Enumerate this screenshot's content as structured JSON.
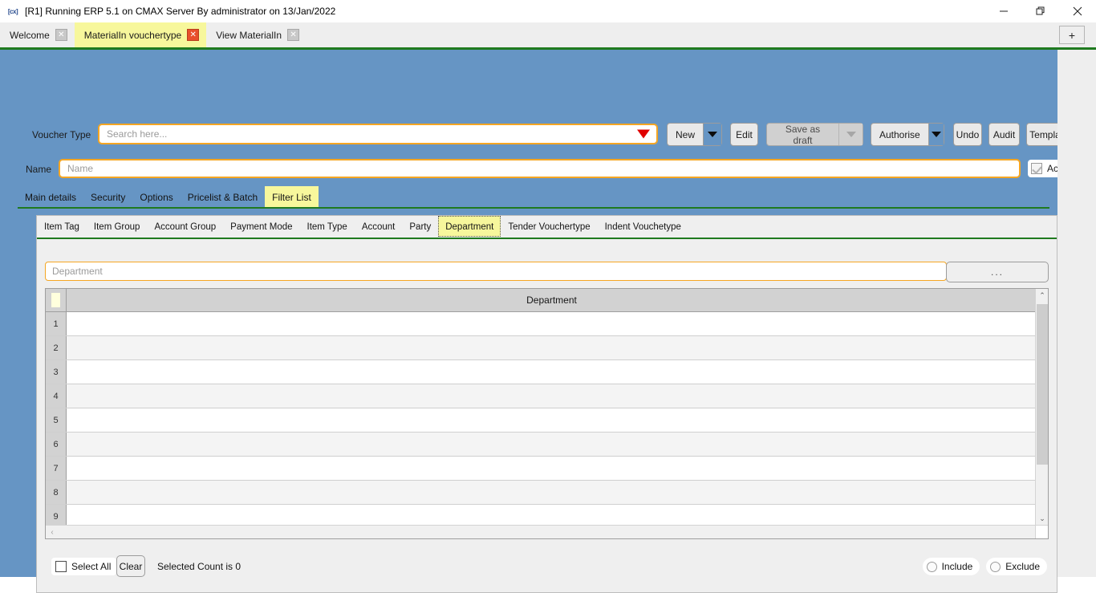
{
  "window": {
    "title": "[R1] Running ERP 5.1 on CMAX Server By administrator on 13/Jan/2022",
    "app_icon": "app-icon",
    "minimize_label": "─",
    "maximize_label": "❐",
    "close_label": "✕"
  },
  "tabs": {
    "items": [
      {
        "label": "Welcome",
        "active": false,
        "close_label": "✕"
      },
      {
        "label": "MaterialIn vouchertype",
        "active": true,
        "close_label": "✕"
      },
      {
        "label": "View MaterialIn",
        "active": false,
        "close_label": "✕"
      }
    ],
    "add_tab_label": "+"
  },
  "form": {
    "voucher_type_label": "Voucher Type",
    "voucher_type_placeholder": "Search here...",
    "voucher_type_value": "",
    "name_label": "Name",
    "name_placeholder": "Name",
    "name_value": "",
    "active_label": "Active"
  },
  "toolbar": {
    "new_label": "New",
    "edit_label": "Edit",
    "save_as_draft_label": "Save as draft",
    "authorise_label": "Authorise",
    "undo_label": "Undo",
    "audit_label": "Audit",
    "template_label": "Template"
  },
  "main_tabs": [
    {
      "label": "Main details",
      "selected": false
    },
    {
      "label": "Security",
      "selected": false
    },
    {
      "label": "Options",
      "selected": false
    },
    {
      "label": "Pricelist & Batch",
      "selected": false
    },
    {
      "label": "Filter List",
      "selected": true
    }
  ],
  "sub_tabs": [
    {
      "label": "Item Tag",
      "selected": false
    },
    {
      "label": "Item Group",
      "selected": false
    },
    {
      "label": "Account Group",
      "selected": false
    },
    {
      "label": "Payment Mode",
      "selected": false
    },
    {
      "label": "Item Type",
      "selected": false
    },
    {
      "label": "Account",
      "selected": false
    },
    {
      "label": "Party",
      "selected": false
    },
    {
      "label": "Department",
      "selected": true
    },
    {
      "label": "Tender Vouchertype",
      "selected": false
    },
    {
      "label": "Indent Vouchetype",
      "selected": false
    }
  ],
  "panel": {
    "search_placeholder": "Department",
    "search_value": "",
    "browse_label": "..."
  },
  "grid": {
    "column_header": "Department",
    "rows": [
      {
        "num": "1",
        "value": ""
      },
      {
        "num": "2",
        "value": ""
      },
      {
        "num": "3",
        "value": ""
      },
      {
        "num": "4",
        "value": ""
      },
      {
        "num": "5",
        "value": ""
      },
      {
        "num": "6",
        "value": ""
      },
      {
        "num": "7",
        "value": ""
      },
      {
        "num": "8",
        "value": ""
      },
      {
        "num": "9",
        "value": ""
      }
    ],
    "scroll_up_label": "⌃",
    "scroll_down_label": "⌄",
    "scroll_left_label": "‹",
    "scroll_right_label": "›"
  },
  "footer": {
    "select_all_label": "Select All",
    "clear_label": "Clear",
    "selected_count_label": "Selected Count is 0",
    "include_label": "Include",
    "exclude_label": "Exclude"
  },
  "colors": {
    "body_blue": "#6695c4",
    "accent_green": "#1f7a1f",
    "tab_yellow": "#f7f79c",
    "field_orange": "#f5a623",
    "close_red": "#e8502a"
  }
}
